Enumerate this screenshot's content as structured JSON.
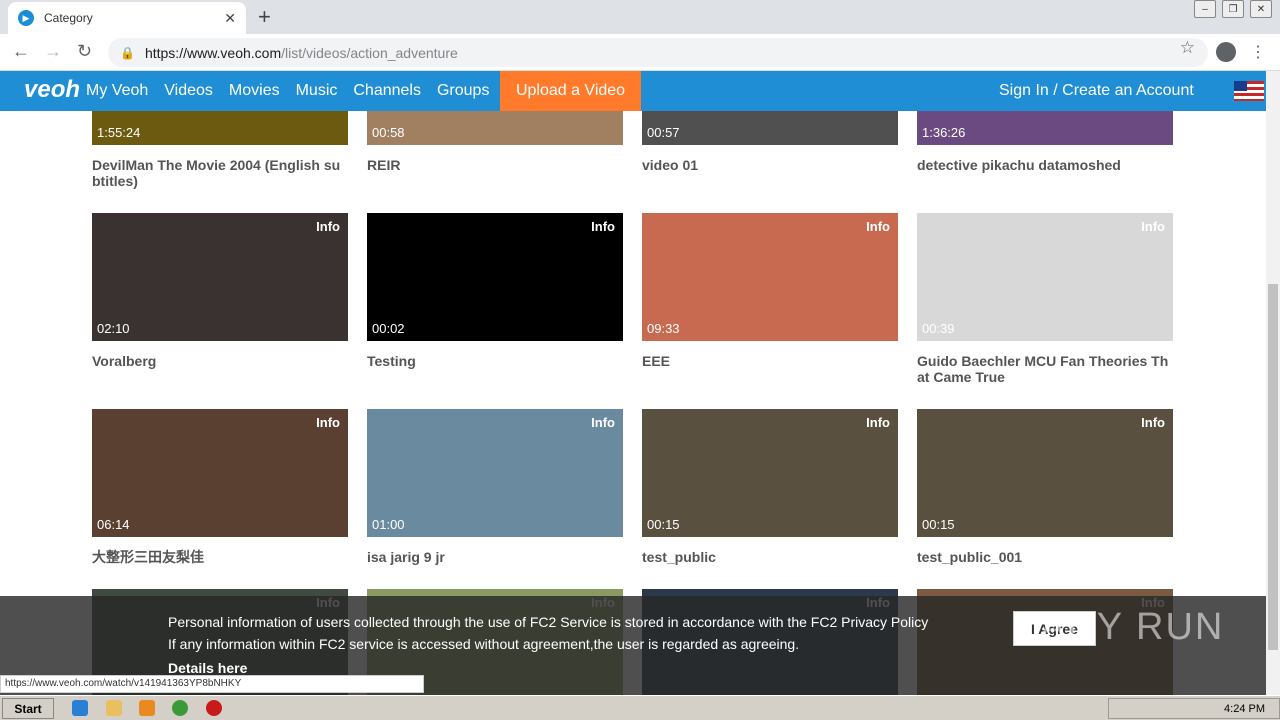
{
  "browser": {
    "tab_title": "Category",
    "url_host": "https://www.veoh.com",
    "url_path": "/list/videos/action_adventure",
    "status_url": "https://www.veoh.com/watch/v141941363YP8bNHKY"
  },
  "site": {
    "logo": "veoh",
    "nav": [
      "My Veoh",
      "Videos",
      "Movies",
      "Music",
      "Channels",
      "Groups"
    ],
    "upload_label": "Upload a Video",
    "signin_label": "Sign In / Create an Account",
    "info_label": "Info"
  },
  "videos": [
    {
      "title": "DevilMan The Movie 2004 (English subtitles)",
      "duration": "1:55:24",
      "color": "#6b5a10"
    },
    {
      "title": "REIR",
      "duration": "00:58",
      "color": "#a08060"
    },
    {
      "title": "video 01",
      "duration": "00:57",
      "color": "#505050"
    },
    {
      "title": "detective pikachu datamoshed",
      "duration": "1:36:26",
      "color": "#6a4a80"
    },
    {
      "title": "Voralberg",
      "duration": "02:10",
      "color": "#3a3230"
    },
    {
      "title": "Testing",
      "duration": "00:02",
      "color": "#000000"
    },
    {
      "title": "EEE",
      "duration": "09:33",
      "color": "#c86a50"
    },
    {
      "title": "Guido Baechler MCU Fan Theories That Came True",
      "duration": "00:39",
      "color": "#d8d8d8"
    },
    {
      "title": "大整形三田友梨佳",
      "duration": "06:14",
      "color": "#5a4030"
    },
    {
      "title": "isa jarig 9 jr",
      "duration": "01:00",
      "color": "#6a8aa0"
    },
    {
      "title": "test_public",
      "duration": "00:15",
      "color": "#5a5040"
    },
    {
      "title": "test_public_001",
      "duration": "00:15",
      "color": "#5a5040"
    },
    {
      "title": "",
      "duration": "",
      "color": "#404a40"
    },
    {
      "title": "",
      "duration": "",
      "color": "#8a9a60"
    },
    {
      "title": "",
      "duration": "",
      "color": "#2a3a4a"
    },
    {
      "title": "",
      "duration": "",
      "color": "#7a5a40"
    }
  ],
  "cookie": {
    "line1": "Personal information of users collected through the use of FC2 Service is stored in accordance with the FC2 Privacy Policy",
    "line2": "If any information within FC2 service is accessed without agreement,the user is regarded as agreeing.",
    "details": "Details here",
    "agree_label": "I Agree"
  },
  "watermark": "ANY RUN",
  "taskbar": {
    "start_label": "Start",
    "clock": "4:24 PM"
  }
}
